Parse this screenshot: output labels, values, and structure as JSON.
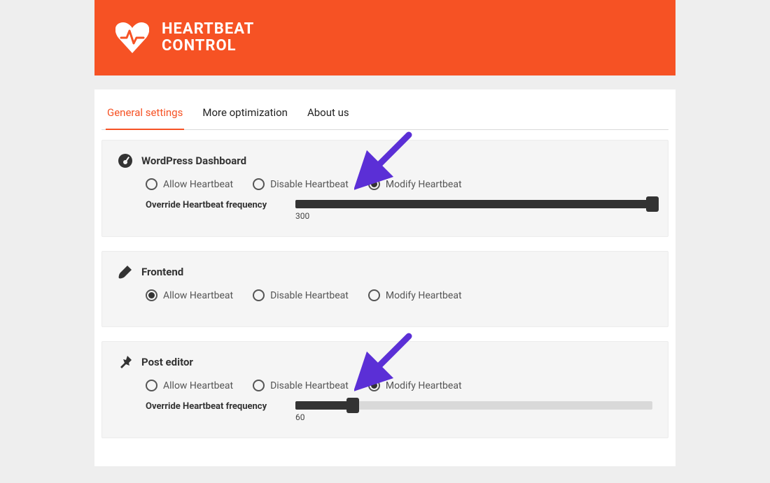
{
  "hero": {
    "title_line1": "HEARTBEAT",
    "title_line2": "CONTROL"
  },
  "tabs": [
    {
      "label": "General settings",
      "active": true
    },
    {
      "label": "More optimization",
      "active": false
    },
    {
      "label": "About us",
      "active": false
    }
  ],
  "sections": {
    "dashboard": {
      "title": "WordPress Dashboard",
      "options": {
        "allow": "Allow Heartbeat",
        "disable": "Disable Heartbeat",
        "modify": "Modify Heartbeat"
      },
      "selected": "modify",
      "override_label": "Override Heartbeat frequency",
      "override_value": "300",
      "fill_pct": "100"
    },
    "frontend": {
      "title": "Frontend",
      "options": {
        "allow": "Allow Heartbeat",
        "disable": "Disable Heartbeat",
        "modify": "Modify Heartbeat"
      },
      "selected": "allow"
    },
    "posteditor": {
      "title": "Post editor",
      "options": {
        "allow": "Allow Heartbeat",
        "disable": "Disable Heartbeat",
        "modify": "Modify Heartbeat"
      },
      "selected": "modify",
      "override_label": "Override Heartbeat frequency",
      "override_value": "60",
      "fill_pct": "16"
    }
  }
}
